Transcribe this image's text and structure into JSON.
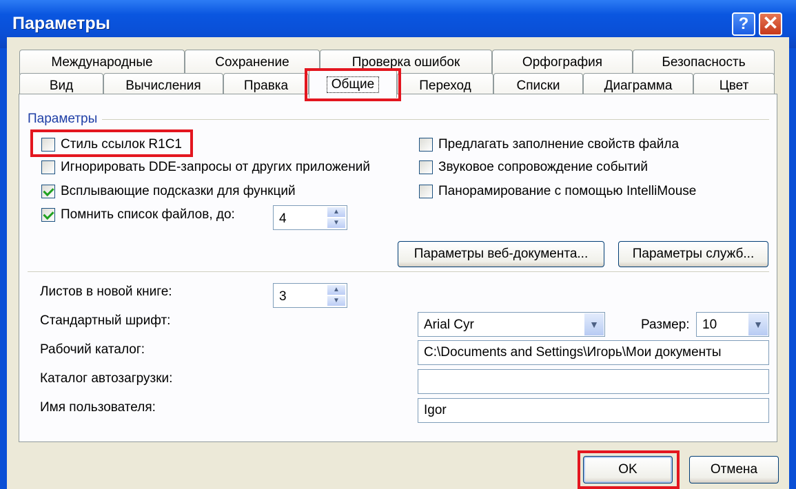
{
  "window": {
    "title": "Параметры",
    "help_button": "?",
    "close_button": "✕"
  },
  "tabs": {
    "row1": [
      "Международные",
      "Сохранение",
      "Проверка ошибок",
      "Орфография",
      "Безопасность"
    ],
    "row2": [
      "Вид",
      "Вычисления",
      "Правка",
      "Общие",
      "Переход",
      "Списки",
      "Диаграмма",
      "Цвет"
    ],
    "active": "Общие"
  },
  "group": {
    "label": "Параметры"
  },
  "checkboxes": {
    "r1c1": {
      "label": "Стиль ссылок R1C1",
      "checked": false
    },
    "ignore_dde": {
      "label": "Игнорировать DDE-запросы от других приложений",
      "checked": false
    },
    "tooltips": {
      "label": "Всплывающие подсказки для функций",
      "checked": true
    },
    "recent_files": {
      "label": "Помнить список файлов, до:",
      "checked": true
    },
    "file_props": {
      "label": "Предлагать заполнение свойств файла",
      "checked": false
    },
    "sound": {
      "label": "Звуковое сопровождение событий",
      "checked": false
    },
    "intellimouse": {
      "label": "Панорамирование с помощью IntelliMouse",
      "checked": false
    }
  },
  "recent_files_count": "4",
  "buttons": {
    "web_options": "Параметры веб-документа...",
    "service_options": "Параметры служб...",
    "ok": "OK",
    "cancel": "Отмена"
  },
  "settings": {
    "sheets_label": "Листов в новой книге:",
    "sheets_value": "3",
    "font_label": "Стандартный шрифт:",
    "font_value": "Arial Cyr",
    "size_label": "Размер:",
    "size_value": "10",
    "workdir_label": "Рабочий каталог:",
    "workdir_value": "C:\\Documents and Settings\\Игорь\\Мои документы",
    "autoload_label": "Каталог автозагрузки:",
    "autoload_value": "",
    "username_label": "Имя пользователя:",
    "username_value": "Igor"
  },
  "colors": {
    "highlight": "#e3161f",
    "titlebar": "#0a4fd6",
    "dialog_bg": "#ece9d8",
    "check": "#21a121"
  }
}
